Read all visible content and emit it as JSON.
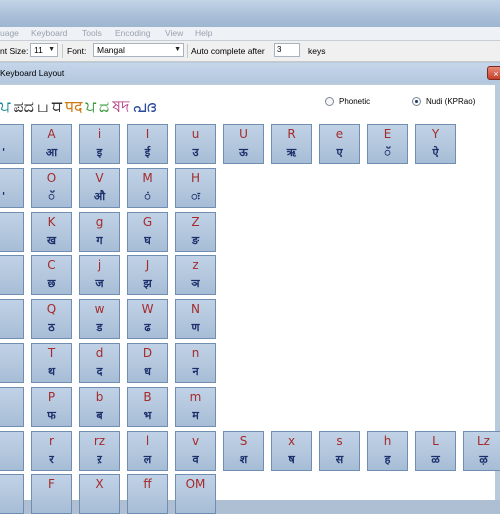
{
  "menu": [
    "uage",
    "Keyboard",
    "Tools",
    "Encoding",
    "View",
    "Help"
  ],
  "toolbar": {
    "font_size_label": "nt Size:",
    "font_size_value": "11",
    "font_label": "Font:",
    "font_value": "Mangal",
    "autocomplete_label": "Auto complete after",
    "autocomplete_value": "3",
    "keys_label": "keys"
  },
  "window": {
    "title": "Keyboard Layout",
    "close_glyph": "×"
  },
  "logo": {
    "parts": [
      {
        "text": "ਪ",
        "color": "#1d8a9a"
      },
      {
        "text": "ಪದ",
        "color": "#2a2a2a"
      },
      {
        "text": "ப",
        "color": "#333333"
      },
      {
        "text": "ਧ",
        "color": "#333333"
      },
      {
        "text": "पद",
        "color": "#d07a10"
      },
      {
        "text": "ਪ",
        "color": "#3c9a3c"
      },
      {
        "text": "ದ",
        "color": "#3c9a3c"
      },
      {
        "text": "ষদ",
        "color": "#b0307a"
      },
      {
        "text": "പദ",
        "color": "#2a4a9a"
      }
    ]
  },
  "options": {
    "phonetic": {
      "label": "Phonetic",
      "selected": false
    },
    "nudi": {
      "label": "Nudi (KPRao)",
      "selected": true
    }
  },
  "keys": [
    [
      {
        "l": "",
        "d": "'"
      },
      {
        "l": "A",
        "d": "आ"
      },
      {
        "l": "i",
        "d": "इ"
      },
      {
        "l": "I",
        "d": "ई"
      },
      {
        "l": "u",
        "d": "उ"
      },
      {
        "l": "U",
        "d": "ऊ"
      },
      {
        "l": "R",
        "d": "ऋ"
      },
      {
        "l": "e",
        "d": "ए"
      },
      {
        "l": "E",
        "d": "ॅ"
      },
      {
        "l": "Y",
        "d": "ऐ"
      }
    ],
    [
      {
        "l": "",
        "d": "'"
      },
      {
        "l": "O",
        "d": "ॅ"
      },
      {
        "l": "V",
        "d": "औ"
      },
      {
        "l": "M",
        "d": "ं"
      },
      {
        "l": "H",
        "d": "ः"
      }
    ],
    [
      {
        "l": "",
        "d": ""
      },
      {
        "l": "K",
        "d": "ख"
      },
      {
        "l": "g",
        "d": "ग"
      },
      {
        "l": "G",
        "d": "घ"
      },
      {
        "l": "Z",
        "d": "ङ"
      }
    ],
    [
      {
        "l": "",
        "d": ""
      },
      {
        "l": "C",
        "d": "छ"
      },
      {
        "l": "j",
        "d": "ज"
      },
      {
        "l": "J",
        "d": "झ"
      },
      {
        "l": "z",
        "d": "ञ"
      }
    ],
    [
      {
        "l": "",
        "d": ""
      },
      {
        "l": "Q",
        "d": "ठ"
      },
      {
        "l": "w",
        "d": "ड"
      },
      {
        "l": "W",
        "d": "ढ"
      },
      {
        "l": "N",
        "d": "ण"
      }
    ],
    [
      {
        "l": "",
        "d": ""
      },
      {
        "l": "T",
        "d": "थ"
      },
      {
        "l": "d",
        "d": "द"
      },
      {
        "l": "D",
        "d": "ध"
      },
      {
        "l": "n",
        "d": "न"
      }
    ],
    [
      {
        "l": "",
        "d": ""
      },
      {
        "l": "P",
        "d": "फ"
      },
      {
        "l": "b",
        "d": "ब"
      },
      {
        "l": "B",
        "d": "भ"
      },
      {
        "l": "m",
        "d": "म"
      }
    ],
    [
      {
        "l": "",
        "d": ""
      },
      {
        "l": "r",
        "d": "र"
      },
      {
        "l": "rz",
        "d": "ऱ"
      },
      {
        "l": "l",
        "d": "ल"
      },
      {
        "l": "v",
        "d": "व"
      },
      {
        "l": "S",
        "d": "श"
      },
      {
        "l": "x",
        "d": "ष"
      },
      {
        "l": "s",
        "d": "स"
      },
      {
        "l": "h",
        "d": "ह"
      },
      {
        "l": "L",
        "d": "ळ"
      },
      {
        "l": "Lz",
        "d": "ऴ"
      }
    ],
    [
      {
        "l": "",
        "d": ""
      },
      {
        "l": "F",
        "d": ""
      },
      {
        "l": "X",
        "d": ""
      },
      {
        "l": "ff",
        "d": ""
      },
      {
        "l": "OM",
        "d": ""
      }
    ]
  ]
}
